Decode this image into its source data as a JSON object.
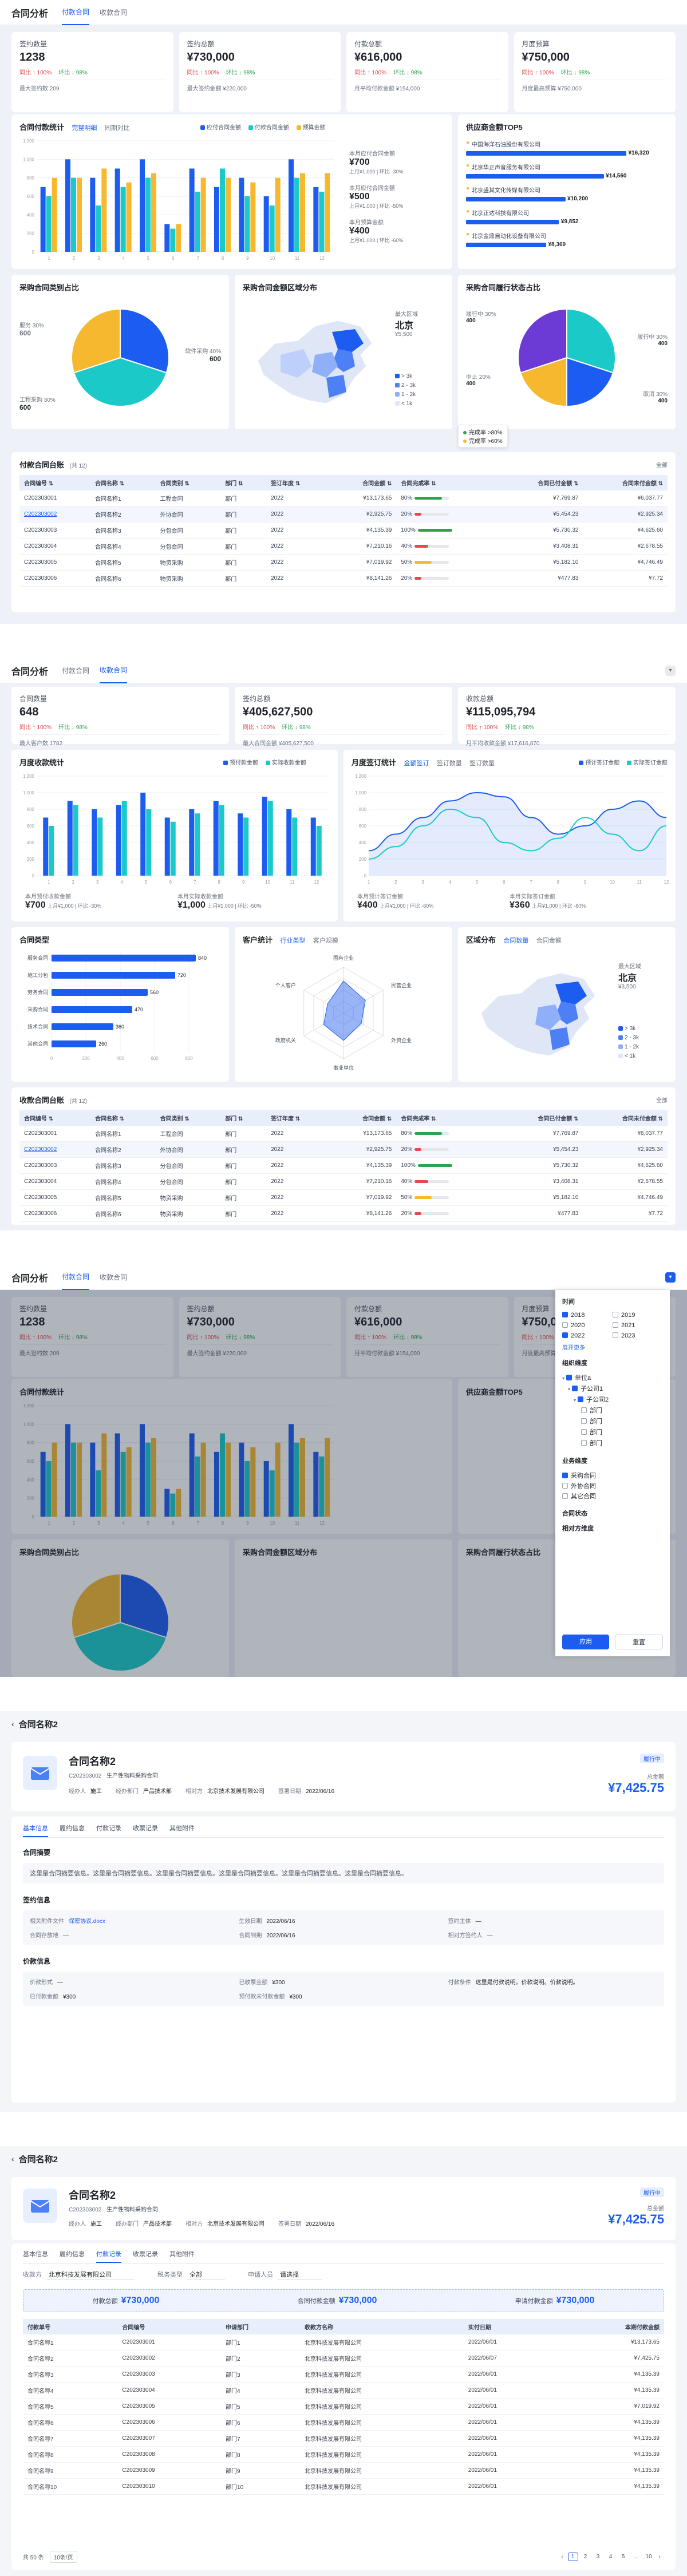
{
  "s1": {
    "title": "合同分析",
    "tabs": [
      "付款合同",
      "收款合同"
    ],
    "kpis": [
      {
        "label": "签约数量",
        "value": "1238",
        "yoy": "同比 ↑ 100%",
        "mom": "环比 ↓ 98%",
        "sub": "最大签约数 209"
      },
      {
        "label": "签约总额",
        "value": "¥730,000",
        "yoy": "同比 ↑ 100%",
        "mom": "环比 ↓ 98%",
        "sub": "最大签约金额 ¥220,000"
      },
      {
        "label": "付款总额",
        "value": "¥616,000",
        "yoy": "同比 ↑ 100%",
        "mom": "环比 ↓ 98%",
        "sub": "月平均付款金额 ¥154,000"
      },
      {
        "label": "月度预算",
        "value": "¥750,000",
        "yoy": "同比 ↑ 100%",
        "mom": "环比 ↓ 98%",
        "sub": "月度最高预算 ¥750,000"
      }
    ],
    "bar_title": "合同付款统计",
    "bar_segs": [
      "完整明细",
      "同期对比"
    ],
    "bar_legend": [
      "应付合同金额",
      "付款合同金额",
      "预算金额"
    ],
    "side_stats": [
      {
        "label": "本月应付合同金额",
        "value": "¥700",
        "note": "上月¥1,000 | 环比 -30%"
      },
      {
        "label": "本月应付合同金额",
        "value": "¥500",
        "note": "上月¥1,000 | 环比 -50%"
      },
      {
        "label": "本月预算金额",
        "value": "¥400",
        "note": "上月¥1,000 | 环比 -60%"
      }
    ],
    "top5_title": "供应商金额TOP5",
    "top5": [
      {
        "name": "中国海洋石油股份有限公司",
        "value": "¥16,320"
      },
      {
        "name": "北京华正声音服务有限公司",
        "value": "¥14,560"
      },
      {
        "name": "北京盛其文化传媒有限公司",
        "value": "¥10,200"
      },
      {
        "name": "北京正达科技有限公司",
        "value": "¥9,852"
      },
      {
        "name": "北京金鼎自动化设备有限公司",
        "value": "¥8,369"
      }
    ],
    "pie1_title": "采购合同类别占比",
    "pie1_labels": [
      "服务 30%",
      "600",
      "软件采购 40%",
      "600",
      "工程采购 30%",
      "600"
    ],
    "map_title": "采购合同金额区域分布",
    "map_info": {
      "label": "最大区域",
      "city": "北京",
      "amount": "¥5,500"
    },
    "map_legend": [
      "> 3k",
      "2 - 3k",
      "1 - 2k",
      "< 1k"
    ],
    "pie2_title": "采购合同履行状态占比",
    "pie2_labels": [
      "履行中 30%",
      "400",
      "履行中 30%",
      "400",
      "中止 20%",
      "400",
      "取消 30%",
      "400"
    ],
    "pie2_tooltip": [
      "完成率 >80%",
      "完成率 >60%"
    ],
    "table_title": "付款合同台账",
    "table_count": "(共 12)",
    "table_more": "全部",
    "table_head": [
      "合同编号",
      "合同名称",
      "合同类别",
      "部门",
      "签订年度",
      "合同金额",
      "合同完成率",
      "合同已付金额",
      "合同未付金额"
    ],
    "rows": [
      [
        "C202303001",
        "合同名称1",
        "工程合同",
        "部门",
        "2022",
        "¥13,173.65",
        "80%",
        "¥7,769.87",
        "¥6,037.77"
      ],
      [
        "C202303002",
        "合同名称2",
        "外协合同",
        "部门",
        "2022",
        "¥2,925.75",
        "20%",
        "¥5,454.23",
        "¥2,925.34"
      ],
      [
        "C202303003",
        "合同名称3",
        "分包合同",
        "部门",
        "2022",
        "¥4,135.39",
        "100%",
        "¥5,730.32",
        "¥4,625.60"
      ],
      [
        "C202303004",
        "合同名称4",
        "分包合同",
        "部门",
        "2022",
        "¥7,210.16",
        "40%",
        "¥3,408.31",
        "¥2,678.55"
      ],
      [
        "C202303005",
        "合同名称5",
        "物资采购",
        "部门",
        "2022",
        "¥7,019.92",
        "50%",
        "¥5,182.10",
        "¥4,746.49"
      ],
      [
        "C202303006",
        "合同名称6",
        "物资采购",
        "部门",
        "2022",
        "¥8,141.26",
        "20%",
        "¥477.83",
        "¥7.72"
      ]
    ]
  },
  "s2": {
    "title": "合同分析",
    "tabs": [
      "付款合同",
      "收款合同"
    ],
    "kpis": [
      {
        "label": "合同数量",
        "value": "648",
        "yoy": "同比 ↑ 100%",
        "mom": "环比 ↓ 98%",
        "sub": "最大客户数 1782"
      },
      {
        "label": "签约总额",
        "value": "¥405,627,500",
        "yoy": "同比 ↑ 100%",
        "mom": "环比 ↓ 98%",
        "sub": "最大合同金额 ¥405,627,500"
      },
      {
        "label": "收款总额",
        "value": "¥115,095,794",
        "yoy": "同比 ↑ 100%",
        "mom": "环比 ↓ 98%",
        "sub": "月平均收款金额 ¥17,616,870"
      }
    ],
    "bar_title": "月度收款统计",
    "bar_legend": [
      "预付款金额",
      "实际收款金额"
    ],
    "bar_stats": [
      {
        "label": "本月预付收款金额",
        "value": "¥700",
        "note": "上月¥1,000 | 环比 -30%"
      },
      {
        "label": "本月实际收款金额",
        "value": "¥1,000",
        "note": "上月¥1,000 | 环比 -50%"
      }
    ],
    "line_title": "月度签订统计",
    "line_tabs": [
      "金额签订",
      "签订数量",
      "签订数量"
    ],
    "line_legend": [
      "预计签订金额",
      "实际签订金额"
    ],
    "line_stats": [
      {
        "label": "本月预计签订金额",
        "value": "¥400",
        "note": "上月¥1,000 | 环比 -60%"
      },
      {
        "label": "本月实际签订金额",
        "value": "¥360",
        "note": "上月¥1,000 | 环比 -60%"
      }
    ],
    "hbar_title": "合同类型",
    "hbar": [
      {
        "name": "服务合同",
        "value": 840
      },
      {
        "name": "施工分包",
        "value": 720
      },
      {
        "name": "劳务合同",
        "value": 560
      },
      {
        "name": "采购合同",
        "value": 470
      },
      {
        "name": "技术合同",
        "value": 360
      },
      {
        "name": "其他合同",
        "value": 260
      }
    ],
    "hbar_axis": [
      "0",
      "200",
      "400",
      "600",
      "800"
    ],
    "radar_title": "客户统计",
    "radar_tabs": [
      "行业类型",
      "客户规模"
    ],
    "radar_labels": [
      "国有企业",
      "民营企业",
      "外资企业",
      "事业单位",
      "政府机关",
      "个人客户"
    ],
    "map2_title": "区域分布",
    "map2_tabs": [
      "合同数量",
      "合同金额"
    ],
    "map2_info": {
      "label": "最大区域",
      "city": "北京",
      "amount": "¥3,500"
    },
    "table_title": "收款合同台账",
    "table_count": "(共 12)",
    "table_more": "全部"
  },
  "s3": {
    "filter": {
      "year_title": "时间",
      "years": [
        "2018",
        "2019",
        "2020",
        "2021",
        "2022",
        "2023"
      ],
      "more": "展开更多",
      "org_title": "组织维度",
      "tree": [
        "单位a",
        "子公司1",
        "子公司2",
        "部门",
        "部门",
        "部门",
        "部门"
      ],
      "type_title": "业务维度",
      "types": [
        "采购合同",
        "外协合同",
        "其它合同"
      ],
      "status_title": "合同状态",
      "party_title": "相对方维度",
      "apply": "应用",
      "reset": "重置"
    }
  },
  "s4": {
    "back": "合同名称2",
    "name": "合同名称2",
    "code": "C202303002",
    "subtitle": "生产性物料采购合同",
    "status": "履行中",
    "meta": [
      {
        "k": "经办人",
        "v": "施工"
      },
      {
        "k": "经办部门",
        "v": "产品技术部"
      },
      {
        "k": "相对方",
        "v": "北京技术发展有限公司"
      },
      {
        "k": "签署日期",
        "v": "2022/06/16"
      }
    ],
    "amount_label": "总金额",
    "amount": "¥7,425.75",
    "tabs": [
      "基本信息",
      "履约信息",
      "付款记录",
      "收票记录",
      "其他附件"
    ],
    "s_summary": "合同摘要",
    "summary_text": "这里是合同摘要信息。这里是合同摘要信息。这里是合同摘要信息。这里是合同摘要信息。这里是合同摘要信息。这里是合同摘要信息。",
    "s_sign": "签约信息",
    "sign_fields": [
      {
        "k": "相关附件文件",
        "v": "保密协议.docx"
      },
      {
        "k": "生效日期",
        "v": "2022/06/16"
      },
      {
        "k": "签约主体",
        "v": "—"
      },
      {
        "k": "合同存放地",
        "v": "—"
      },
      {
        "k": "合同到期",
        "v": "2022/06/16"
      },
      {
        "k": "相对方签约人",
        "v": "—"
      }
    ],
    "s_pay": "价款信息",
    "pay_fields": [
      {
        "k": "价款形式",
        "v": "—"
      },
      {
        "k": "已收票金额",
        "v": "¥300"
      },
      {
        "k": "付款条件",
        "v": "这里是付款说明。价款说明。价款说明。"
      },
      {
        "k": "已付款金额",
        "v": "¥300"
      },
      {
        "k": "预付款未付款金额",
        "v": "¥300"
      }
    ]
  },
  "s5": {
    "back": "合同名称2",
    "tabs": [
      "基本信息",
      "履约信息",
      "付款记录",
      "收票记录",
      "其他附件"
    ],
    "filters": [
      {
        "k": "收款方",
        "v": "北京科技发展有限公司"
      },
      {
        "k": "税务类型",
        "v": "全部"
      },
      {
        "k": "申请人员",
        "v": "请选择"
      }
    ],
    "totals": [
      {
        "k": "付款总额",
        "v": "¥730,000"
      },
      {
        "k": "合同付款金额",
        "v": "¥730,000"
      },
      {
        "k": "申请付款金额",
        "v": "¥730,000"
      }
    ],
    "head": [
      "付款单号",
      "合同编号",
      "申请部门",
      "收款方名称",
      "实付日期",
      "本期付款金额"
    ],
    "rows": [
      [
        "合同名称1",
        "C202303001",
        "部门1",
        "北京科技发展有限公司",
        "2022/06/01",
        "¥13,173.65"
      ],
      [
        "合同名称2",
        "C202303002",
        "部门2",
        "北京科技发展有限公司",
        "2022/06/07",
        "¥7,425.75"
      ],
      [
        "合同名称3",
        "C202303003",
        "部门3",
        "北京科技发展有限公司",
        "2022/06/01",
        "¥4,135.39"
      ],
      [
        "合同名称4",
        "C202303004",
        "部门4",
        "北京科技发展有限公司",
        "2022/06/01",
        "¥4,135.39"
      ],
      [
        "合同名称5",
        "C202303005",
        "部门5",
        "北京科技发展有限公司",
        "2022/06/01",
        "¥7,019.92"
      ],
      [
        "合同名称6",
        "C202303006",
        "部门6",
        "北京科技发展有限公司",
        "2022/06/01",
        "¥4,135.39"
      ],
      [
        "合同名称7",
        "C202303007",
        "部门7",
        "北京科技发展有限公司",
        "2022/06/01",
        "¥4,135.39"
      ],
      [
        "合同名称8",
        "C202303008",
        "部门8",
        "北京科技发展有限公司",
        "2022/06/01",
        "¥4,135.39"
      ],
      [
        "合同名称9",
        "C202303009",
        "部门9",
        "北京科技发展有限公司",
        "2022/06/01",
        "¥4,135.39"
      ],
      [
        "合同名称10",
        "C202303010",
        "部门10",
        "北京科技发展有限公司",
        "2022/06/01",
        "¥4,135.39"
      ]
    ],
    "pager_total": "共 50 条",
    "pager_size": "10条/页",
    "pages": [
      "1",
      "2",
      "3",
      "4",
      "5",
      "...",
      "10"
    ]
  },
  "chart_data": [
    {
      "type": "bar",
      "title": "合同付款统计",
      "categories": [
        "1",
        "2",
        "3",
        "4",
        "5",
        "6",
        "7",
        "8",
        "9",
        "10",
        "11",
        "12"
      ],
      "series": [
        {
          "name": "应付合同金额",
          "values": [
            700,
            1000,
            800,
            900,
            1000,
            300,
            900,
            700,
            800,
            600,
            1000,
            700
          ]
        },
        {
          "name": "付款合同金额",
          "values": [
            600,
            800,
            500,
            700,
            800,
            250,
            650,
            900,
            600,
            500,
            800,
            650
          ]
        },
        {
          "name": "预算金额",
          "values": [
            800,
            800,
            900,
            750,
            850,
            300,
            800,
            800,
            750,
            800,
            850,
            850
          ]
        }
      ],
      "ylim": [
        0,
        1200
      ]
    },
    {
      "type": "pie",
      "title": "采购合同类别占比",
      "categories": [
        "服务",
        "软件采购",
        "工程采购"
      ],
      "values": [
        30,
        40,
        30
      ]
    },
    {
      "type": "pie",
      "title": "采购合同履行状态占比",
      "categories": [
        "履行中",
        "履行中",
        "中止",
        "取消"
      ],
      "values": [
        30,
        20,
        20,
        30
      ]
    },
    {
      "type": "bar",
      "title": "月度收款统计",
      "categories": [
        "1",
        "2",
        "3",
        "4",
        "5",
        "6",
        "7",
        "8",
        "9",
        "10",
        "11",
        "12"
      ],
      "series": [
        {
          "name": "预付款金额",
          "values": [
            700,
            900,
            800,
            850,
            1000,
            700,
            800,
            900,
            750,
            950,
            800,
            700
          ]
        },
        {
          "name": "实际收款金额",
          "values": [
            600,
            850,
            700,
            900,
            800,
            650,
            750,
            850,
            700,
            900,
            700,
            600
          ]
        }
      ],
      "ylim": [
        0,
        1200
      ]
    },
    {
      "type": "line",
      "title": "月度签订统计",
      "categories": [
        "1",
        "2",
        "3",
        "4",
        "5",
        "6",
        "7",
        "8",
        "9",
        "10",
        "11",
        "12"
      ],
      "series": [
        {
          "name": "预计签订金额",
          "values": [
            300,
            500,
            700,
            900,
            1000,
            950,
            700,
            500,
            600,
            800,
            900,
            700
          ]
        },
        {
          "name": "实际签订金额",
          "values": [
            200,
            350,
            600,
            800,
            700,
            400,
            300,
            450,
            700,
            500,
            300,
            600
          ]
        }
      ],
      "ylim": [
        0,
        1200
      ]
    },
    {
      "type": "bar",
      "title": "合同类型",
      "categories": [
        "服务合同",
        "施工分包",
        "劳务合同",
        "采购合同",
        "技术合同",
        "其他合同"
      ],
      "values": [
        840,
        720,
        560,
        470,
        360,
        260
      ],
      "xlim": [
        0,
        900
      ]
    }
  ],
  "colors": {
    "blue": "#1c5cf0",
    "cyan": "#1bc9c9",
    "yellow": "#f5b82e",
    "purple": "#6c3bd6",
    "red": "#e5484d",
    "green": "#2ea44f"
  }
}
